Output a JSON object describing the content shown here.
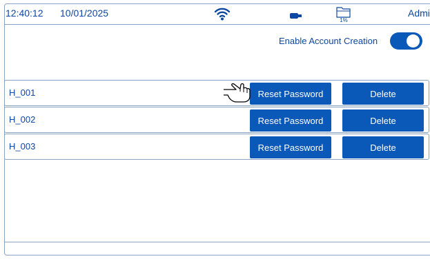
{
  "status_bar": {
    "time": "12:40:12",
    "date": "10/01/2025",
    "storage_percent": "1%",
    "user": "Admin",
    "icons": [
      "wifi-icon",
      "usb-icon",
      "folder-icon"
    ]
  },
  "settings": {
    "account_creation_label": "Enable Account Creation",
    "account_creation_enabled": true
  },
  "accounts": [
    {
      "name": "H_001",
      "reset_label": "Reset Password",
      "delete_label": "Delete"
    },
    {
      "name": "H_002",
      "reset_label": "Reset Password",
      "delete_label": "Delete"
    },
    {
      "name": "H_003",
      "reset_label": "Reset Password",
      "delete_label": "Delete"
    }
  ],
  "colors": {
    "accent": "#0a58b8",
    "text": "#0d47a1",
    "border": "#8aa3bf"
  }
}
